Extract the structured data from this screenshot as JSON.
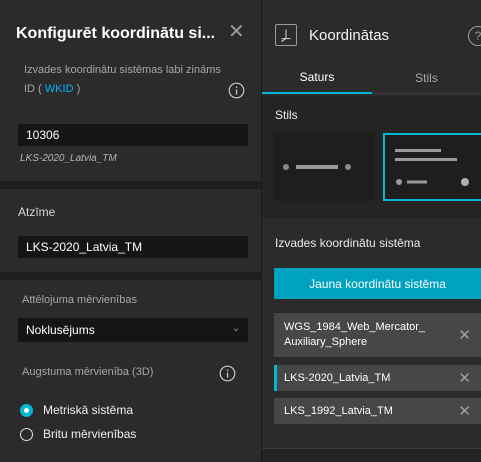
{
  "left_panel": {
    "title": "Konfigurēt koordinātu si...",
    "id_label_prefix": "Izvades koordinātu sistēmas labi zināms ID (",
    "id_label_link": "WKID",
    "id_label_suffix": ")",
    "wkid_value": "10306",
    "wkid_name": "LKS-2020_Latvia_TM",
    "label_section": "Atzīme",
    "label_value": "LKS-2020_Latvia_TM",
    "units_label": "Attēlojuma mērvienības",
    "units_value": "Noklusējums",
    "height_units_label": "Augstuma mērvienība (3D)",
    "radio_metric": "Metriskā sistēma",
    "radio_imperial": "Britu mērvienības",
    "selected_radio": "metric"
  },
  "right_panel": {
    "title": "Koordinātas",
    "tabs": [
      {
        "label": "Saturs",
        "active": true
      },
      {
        "label": "Stils",
        "active": false
      }
    ],
    "style_label": "Stils",
    "selected_style": 2,
    "output_section_title": "Izvades koordinātu sistēma",
    "new_button_label": "Jauna koordinātu sistēma",
    "coordinate_systems": [
      {
        "name": "WGS_1984_Web_Mercator_ Auxiliary_Sphere",
        "active": false
      },
      {
        "name": "LKS-2020_Latvia_TM",
        "active": true
      },
      {
        "name": "LKS_1992_Latvia_TM",
        "active": false
      }
    ]
  },
  "colors": {
    "accent": "#00b7d4",
    "button": "#00a2c0",
    "link": "#00b4ff",
    "panel": "#2b2b2b",
    "field": "#151515"
  },
  "icons": [
    "close-icon",
    "info-icon",
    "chevron-down-icon",
    "coordinates-icon",
    "help-icon"
  ]
}
